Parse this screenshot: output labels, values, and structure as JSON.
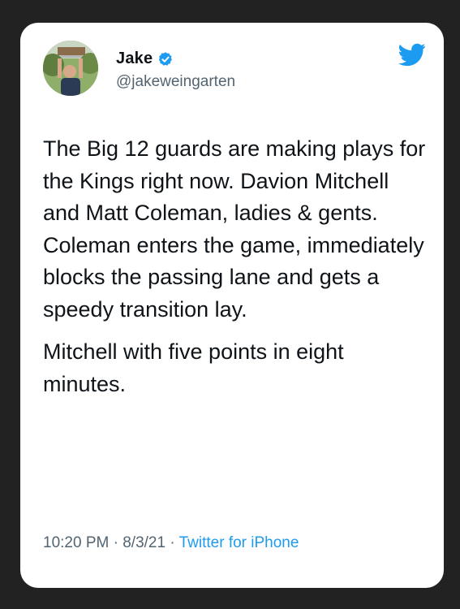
{
  "tweet": {
    "author": {
      "display_name": "Jake",
      "handle": "@jakeweingarten",
      "verified": true,
      "avatar_icon": "profile-photo"
    },
    "paragraphs": [
      "The Big 12 guards are making plays for the Kings right now. Davion Mitchell and Matt Coleman, ladies & gents. Coleman enters the game, immediately blocks the passing lane and gets a speedy transition lay.",
      "Mitchell with five points in eight minutes."
    ],
    "time": "10:20 PM",
    "date": "8/3/21",
    "separator": " · ",
    "source": "Twitter for iPhone"
  },
  "colors": {
    "background": "#222222",
    "card": "#ffffff",
    "text": "#0f1419",
    "secondary": "#536471",
    "accent": "#1d9bf0"
  },
  "icons": {
    "brand": "twitter-bird-icon",
    "verified": "verified-badge-icon"
  }
}
